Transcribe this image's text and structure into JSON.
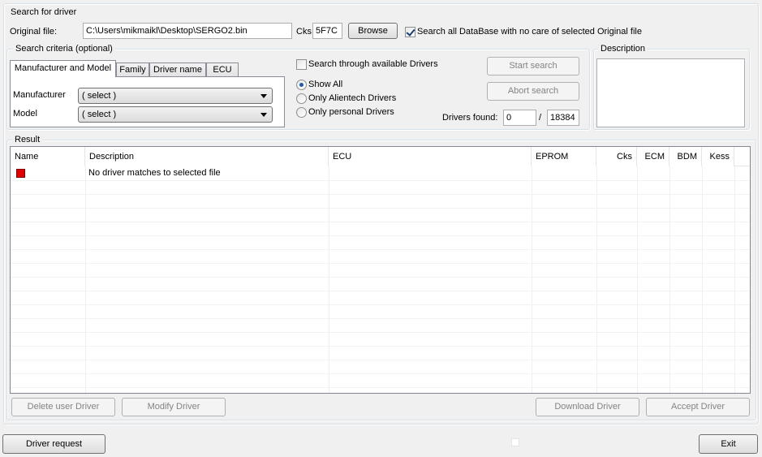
{
  "search_group": {
    "title": "Search for driver",
    "original_file_label": "Original file:",
    "original_file_value": "C:\\Users\\mikmaikl\\Desktop\\SERGO2.bin",
    "cks_label": "Cks",
    "cks_value": "5F7C",
    "browse_label": "Browse",
    "search_all_label": "Search all DataBase with no care of selected Original file",
    "search_all_checked": true
  },
  "criteria": {
    "title": "Search criteria (optional)",
    "tabs": [
      {
        "label": "Manufacturer and Model",
        "active": true
      },
      {
        "label": "Family",
        "active": false
      },
      {
        "label": "Driver name",
        "active": false
      },
      {
        "label": "ECU",
        "active": false
      }
    ],
    "manufacturer_label": "Manufacturer",
    "manufacturer_value": "( select )",
    "model_label": "Model",
    "model_value": "( select )"
  },
  "options": {
    "search_available_label": "Search through available Drivers",
    "search_available_checked": false,
    "radios": [
      {
        "label": "Show All",
        "checked": true
      },
      {
        "label": "Only Alientech Drivers",
        "checked": false
      },
      {
        "label": "Only personal Drivers",
        "checked": false
      }
    ],
    "start_search_label": "Start search",
    "abort_search_label": "Abort search",
    "drivers_found_label": "Drivers found:",
    "drivers_found_value": "0",
    "separator": "/",
    "drivers_total_value": "18384"
  },
  "description": {
    "title": "Description",
    "value": ""
  },
  "result": {
    "title": "Result",
    "columns": [
      "Name",
      "Description",
      "ECU",
      "EPROM",
      "Cks",
      "ECM",
      "BDM",
      "Kess"
    ],
    "rows": [
      {
        "status_color": "#e00000",
        "name": "",
        "description": "No driver matches to selected file",
        "ecu": "",
        "eprom": "",
        "cks": "",
        "ecm": "",
        "bdm": "",
        "kess": ""
      }
    ],
    "delete_label": "Delete user Driver",
    "modify_label": "Modify Driver",
    "download_label": "Download Driver",
    "accept_label": "Accept Driver"
  },
  "footer": {
    "driver_request_label": "Driver request",
    "exit_label": "Exit"
  }
}
